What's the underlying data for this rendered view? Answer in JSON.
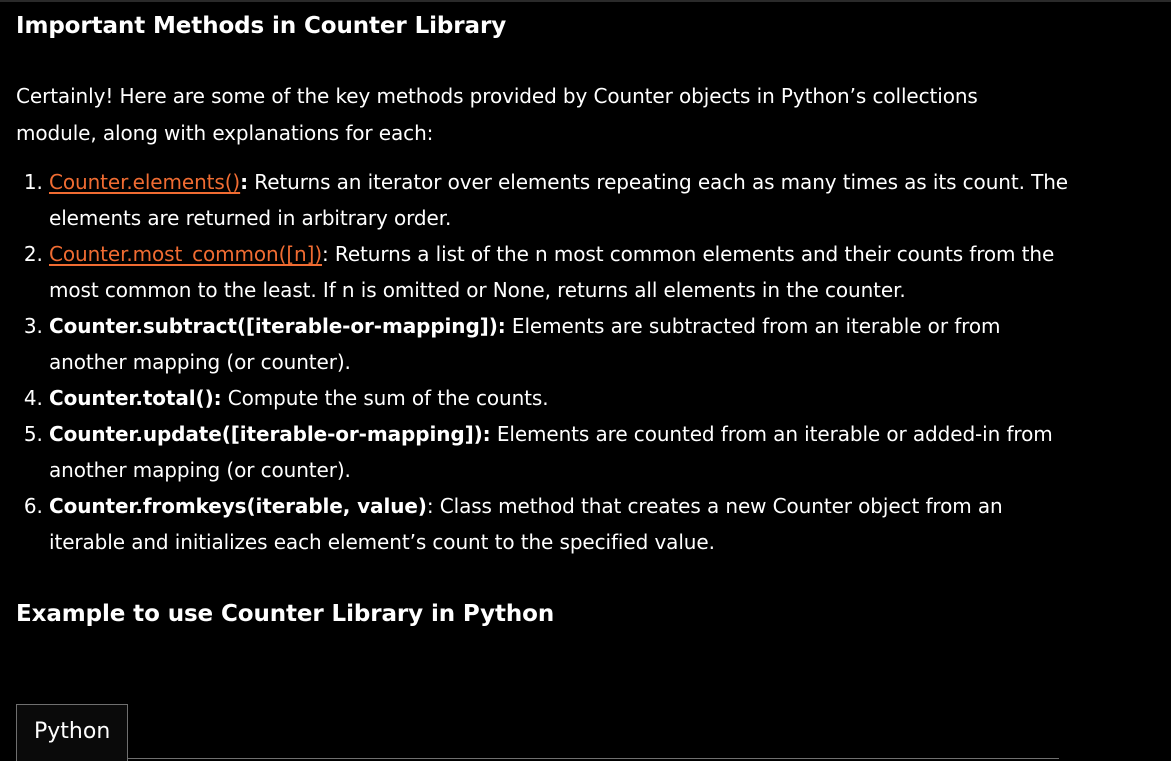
{
  "heading_methods": "Important Methods in Counter Library",
  "intro": "Certainly! Here are some of the key methods provided by Counter objects in Python’s collections module, along with explanations for each:",
  "methods": [
    {
      "num": "1.",
      "name": "Counter.elements()",
      "sep": ":",
      "desc": " Returns an iterator over elements repeating each as many times as its count. The elements are returned in arbitrary order."
    },
    {
      "num": "2.",
      "name": "Counter.most_common([n])",
      "sep": ":",
      "desc": " Returns a list of the n most common elements and their counts from the most common to the least. If n is omitted or None, returns all elements in the counter."
    },
    {
      "num": "3.",
      "name": "Counter.subtract([iterable-or-mapping])",
      "sep": ":",
      "desc": " Elements are subtracted from an iterable or from another mapping (or counter)."
    },
    {
      "num": "4.",
      "name": "Counter.total():",
      "sep": "",
      "desc": " Compute the sum of the counts."
    },
    {
      "num": "5.",
      "name": "Counter.update([iterable-or-mapping])",
      "sep": ":",
      "desc": " Elements are counted from an iterable or added-in from another mapping (or counter)."
    },
    {
      "num": "6.",
      "name": "Counter.fromkeys(iterable, value)",
      "sep": ":",
      "desc": " Class method that creates a new Counter object from an iterable and initializes each element’s count to the specified value."
    }
  ],
  "heading_example": "Example to use Counter Library in Python",
  "tab_label": "Python",
  "colors": {
    "background": "#000000",
    "text": "#ffffff",
    "link": "#f06c32",
    "border": "#6f6f6f"
  }
}
